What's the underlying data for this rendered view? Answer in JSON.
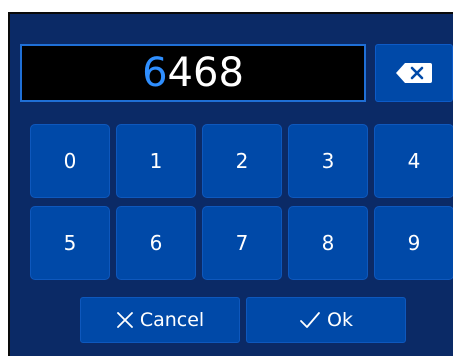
{
  "keypad": {
    "display": {
      "first_digit": "6",
      "rest_digits": "468"
    },
    "keys": {
      "k0": "0",
      "k1": "1",
      "k2": "2",
      "k3": "3",
      "k4": "4",
      "k5": "5",
      "k6": "6",
      "k7": "7",
      "k8": "8",
      "k9": "9"
    },
    "cancel_label": "Cancel",
    "ok_label": "Ok"
  },
  "colors": {
    "background": "#0b2a66",
    "key": "#0049a8",
    "display_bg": "#000000",
    "display_border": "#1f6fd6",
    "accent_digit": "#2f8fff"
  },
  "icons": {
    "backspace": "backspace-icon",
    "cancel": "close-icon",
    "ok": "checkmark-icon"
  }
}
